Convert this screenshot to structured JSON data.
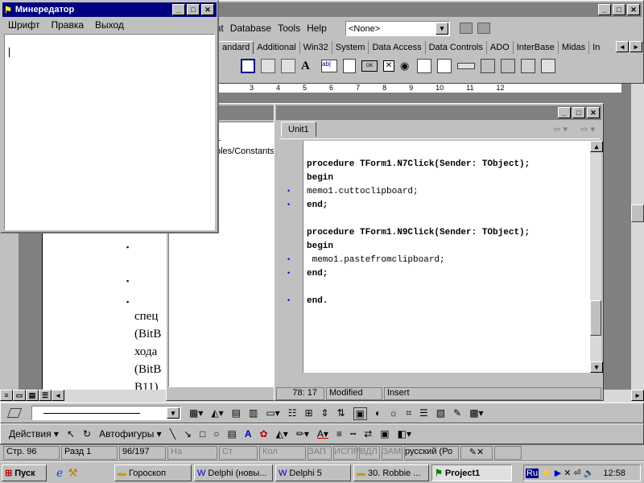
{
  "delphi": {
    "menu": [
      "ent",
      "Database",
      "Tools",
      "Help"
    ],
    "combo": "<None>",
    "tabs": [
      "andard",
      "Additional",
      "Win32",
      "System",
      "Data Access",
      "Data Controls",
      "ADO",
      "InterBase",
      "Midas",
      "In"
    ],
    "ruler": [
      "3",
      "4",
      "5",
      "6",
      "7",
      "8",
      "9",
      "10",
      "11",
      "12"
    ]
  },
  "editor": {
    "title": "",
    "tab": "Unit1",
    "tree": [
      "1",
      "bles/Constants"
    ],
    "code": [
      {
        "t": ""
      },
      {
        "t": "procedure TForm1.N7Click(Sender: TObject);",
        "m": ""
      },
      {
        "t": "begin",
        "m": ""
      },
      {
        "t": "memo1.cuttoclipboard;",
        "m": "•"
      },
      {
        "t": "end;",
        "m": "•"
      },
      {
        "t": ""
      },
      {
        "t": "procedure TForm1.N9Click(Sender: TObject);",
        "m": ""
      },
      {
        "t": "begin",
        "m": ""
      },
      {
        "t": " memo1.pastefromclipboard;",
        "m": "•"
      },
      {
        "t": "end;",
        "m": "•"
      },
      {
        "t": ""
      },
      {
        "t": "end.",
        "m": "•"
      }
    ],
    "status": {
      "pos": "78: 17",
      "state": "Modified",
      "mode": "Insert"
    }
  },
  "doc": {
    "bullets": [
      "▪",
      "▪",
      "▪"
    ],
    "lines": [
      "спец",
      "(BitB",
      "хода",
      "(BitB",
      "B11)"
    ]
  },
  "mini": {
    "title": "Минередатор",
    "menu": [
      "Шрифт",
      "Правка",
      "Выход"
    ]
  },
  "word": {
    "actions": "Действия",
    "autoshapes": "Автофигуры",
    "status": [
      "Стр. 96",
      "Разд 1",
      "96/197",
      "На",
      "Ст",
      "Кол",
      "ЗАП",
      "ИСПР",
      "ВДЛ",
      "ЗАМ",
      "русский (Ро"
    ]
  },
  "taskbar": {
    "start": "Пуск",
    "tasks": [
      "Гороскоп",
      "Delphi (новы...",
      "Delphi 5",
      "30. Robbie ...",
      "Project1"
    ],
    "lang": "Ru",
    "clock": "12:58"
  }
}
